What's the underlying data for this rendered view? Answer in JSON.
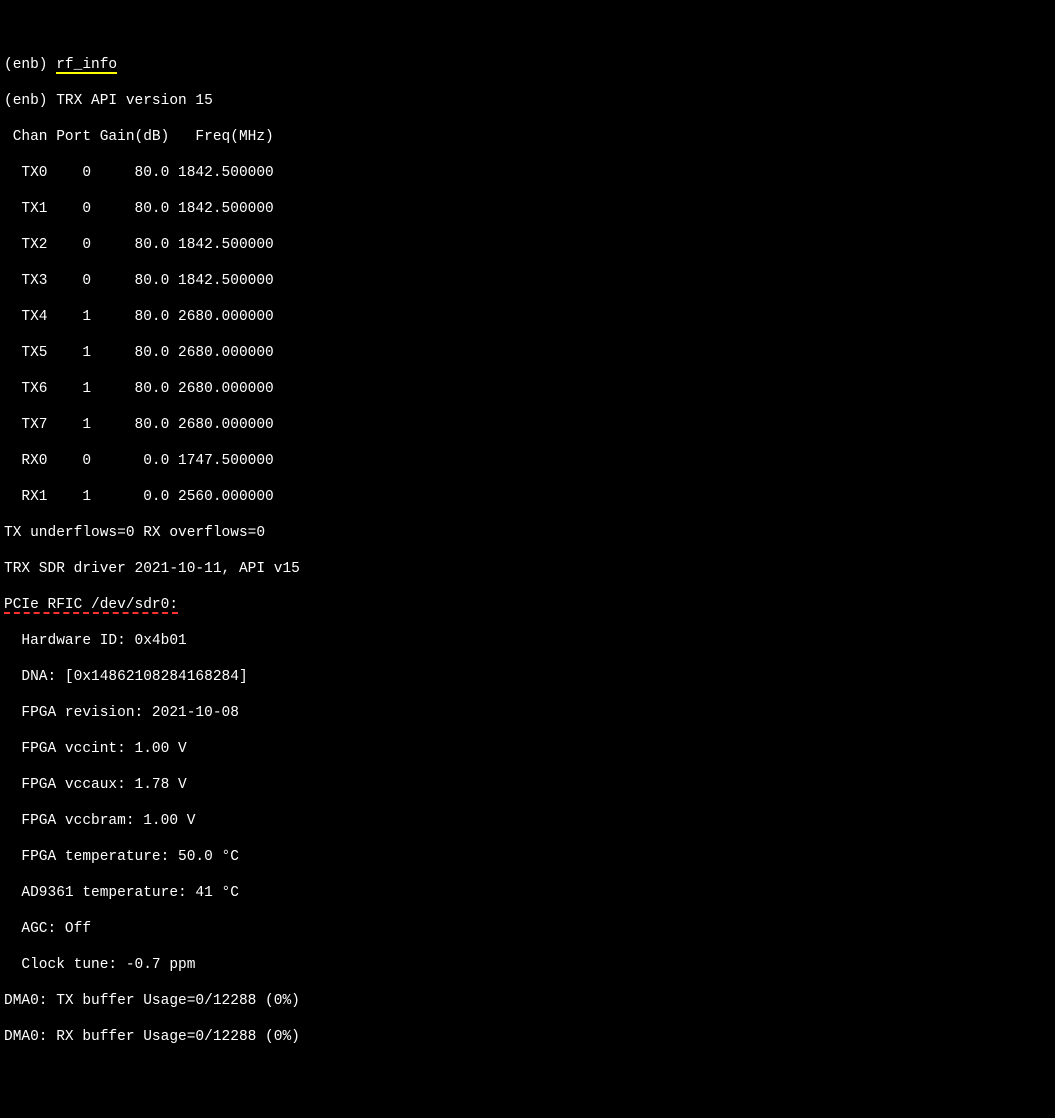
{
  "line1": {
    "prefix": "(enb) ",
    "cmd": "rf_info"
  },
  "line2": "(enb) TRX API version 15",
  "table": {
    "header": " Chan Port Gain(dB)   Freq(MHz)",
    "rows": [
      "  TX0    0     80.0 1842.500000",
      "  TX1    0     80.0 1842.500000",
      "  TX2    0     80.0 1842.500000",
      "  TX3    0     80.0 1842.500000",
      "  TX4    1     80.0 2680.000000",
      "  TX5    1     80.0 2680.000000",
      "  TX6    1     80.0 2680.000000",
      "  TX7    1     80.0 2680.000000",
      "  RX0    0      0.0 1747.500000",
      "  RX1    1      0.0 2560.000000"
    ]
  },
  "flows": "TX underflows=0 RX overflows=0",
  "driver": "TRX SDR driver 2021-10-11, API v15",
  "rfic": "PCIe RFIC /dev/sdr0:",
  "info": [
    "  Hardware ID: 0x4b01",
    "  DNA: [0x14862108284168284]",
    "  FPGA revision: 2021-10-08",
    "  FPGA vccint: 1.00 V",
    "  FPGA vccaux: 1.78 V",
    "  FPGA vccbram: 1.00 V",
    "  FPGA temperature: 50.0 °C",
    "  AD9361 temperature: 41 °C",
    "  AGC: Off",
    "  Clock tune: -0.7 ppm"
  ],
  "dma0": "DMA0: TX buffer Usage=0/12288 (0%)",
  "dma1": "DMA0: RX buffer Usage=0/12288 (0%)"
}
